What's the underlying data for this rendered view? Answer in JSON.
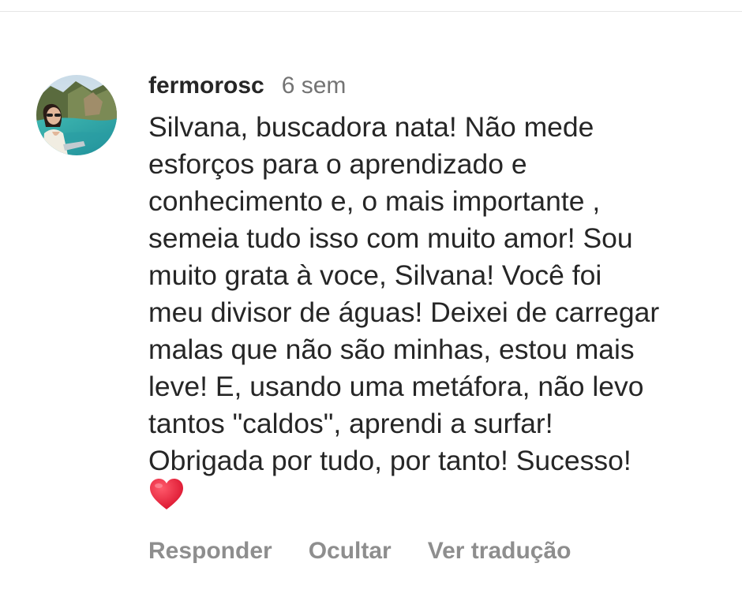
{
  "comment": {
    "username": "fermorosc",
    "time": "6 sem",
    "lines": [
      "Silvana, buscadora nata! Não mede",
      "esforços para o aprendizado e",
      "conhecimento e, o mais importante ,",
      "semeia tudo isso com muito amor! Sou",
      "muito grata à voce, Silvana! Você foi",
      "meu divisor de águas! Deixei de carregar",
      "malas que não são minhas, estou mais",
      "leve! E, usando uma metáfora, não levo",
      "tantos \"caldos\", aprendi a surfar!",
      "Obrigada por tudo, por tanto! Sucesso!"
    ],
    "emoji": "red-heart-icon"
  },
  "actions": {
    "reply": "Responder",
    "hide": "Ocultar",
    "translate": "Ver tradução"
  },
  "colors": {
    "text": "#262626",
    "muted": "#737373",
    "action": "#8e8e8e",
    "heart": "#e8132f"
  }
}
